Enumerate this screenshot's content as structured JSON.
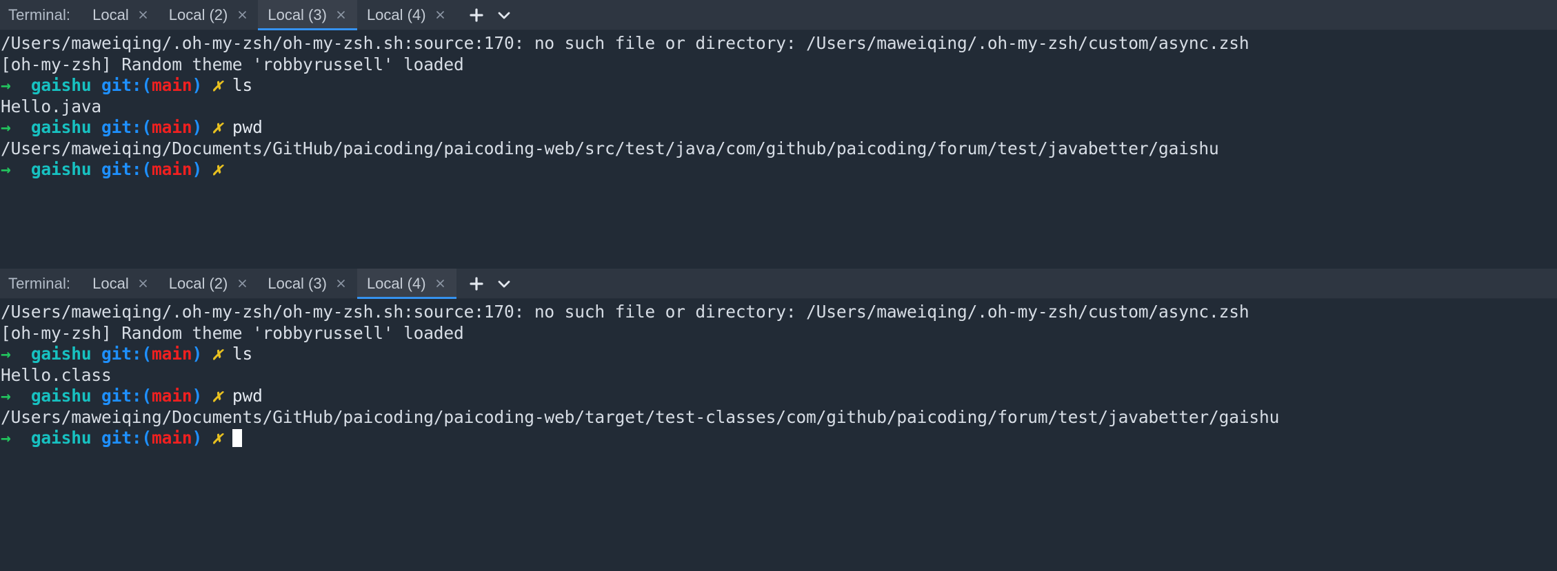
{
  "theme": {
    "terminal_bg": "#222b36",
    "tabbar_bg": "#2e3641",
    "active_tab_bg": "#39404b",
    "active_tab_underline": "#3592f0",
    "text": "#d7dde5",
    "prompt_arrow": "#22c55e",
    "prompt_dir": "#17c1c1",
    "prompt_git": "#1e90ff",
    "prompt_branch": "#f02020",
    "prompt_dirty": "#e8c020"
  },
  "terminals": [
    {
      "tabbar": {
        "label": "Terminal:",
        "tabs": [
          {
            "title": "Local",
            "close": "×",
            "active": false
          },
          {
            "title": "Local (2)",
            "close": "×",
            "active": false
          },
          {
            "title": "Local (3)",
            "close": "×",
            "active": true
          },
          {
            "title": "Local (4)",
            "close": "×",
            "active": false
          }
        ],
        "add_tab_label": "+",
        "options_label": "⌄"
      },
      "lines": [
        {
          "type": "output",
          "text": "/Users/maweiqing/.oh-my-zsh/oh-my-zsh.sh:source:170: no such file or directory: /Users/maweiqing/.oh-my-zsh/custom/async.zsh"
        },
        {
          "type": "output",
          "text": "[oh-my-zsh] Random theme 'robbyrussell' loaded"
        },
        {
          "type": "prompt",
          "arrow": "→",
          "dir": "gaishu",
          "git_open": "git:(",
          "branch": "main",
          "git_close": ")",
          "dirty": "✗",
          "command": "ls"
        },
        {
          "type": "output",
          "text": "Hello.java"
        },
        {
          "type": "prompt",
          "arrow": "→",
          "dir": "gaishu",
          "git_open": "git:(",
          "branch": "main",
          "git_close": ")",
          "dirty": "✗",
          "command": "pwd"
        },
        {
          "type": "output",
          "text": "/Users/maweiqing/Documents/GitHub/paicoding/paicoding-web/src/test/java/com/github/paicoding/forum/test/javabetter/gaishu"
        },
        {
          "type": "prompt",
          "arrow": "→",
          "dir": "gaishu",
          "git_open": "git:(",
          "branch": "main",
          "git_close": ")",
          "dirty": "✗",
          "command": ""
        }
      ]
    },
    {
      "tabbar": {
        "label": "Terminal:",
        "tabs": [
          {
            "title": "Local",
            "close": "×",
            "active": false
          },
          {
            "title": "Local (2)",
            "close": "×",
            "active": false
          },
          {
            "title": "Local (3)",
            "close": "×",
            "active": false
          },
          {
            "title": "Local (4)",
            "close": "×",
            "active": true
          }
        ],
        "add_tab_label": "+",
        "options_label": "⌄"
      },
      "lines": [
        {
          "type": "output",
          "text": "/Users/maweiqing/.oh-my-zsh/oh-my-zsh.sh:source:170: no such file or directory: /Users/maweiqing/.oh-my-zsh/custom/async.zsh"
        },
        {
          "type": "output",
          "text": "[oh-my-zsh] Random theme 'robbyrussell' loaded"
        },
        {
          "type": "prompt",
          "arrow": "→",
          "dir": "gaishu",
          "git_open": "git:(",
          "branch": "main",
          "git_close": ")",
          "dirty": "✗",
          "command": "ls"
        },
        {
          "type": "output",
          "text": "Hello.class"
        },
        {
          "type": "prompt",
          "arrow": "→",
          "dir": "gaishu",
          "git_open": "git:(",
          "branch": "main",
          "git_close": ")",
          "dirty": "✗",
          "command": "pwd"
        },
        {
          "type": "output",
          "text": "/Users/maweiqing/Documents/GitHub/paicoding/paicoding-web/target/test-classes/com/github/paicoding/forum/test/javabetter/gaishu"
        },
        {
          "type": "prompt",
          "arrow": "→",
          "dir": "gaishu",
          "git_open": "git:(",
          "branch": "main",
          "git_close": ")",
          "dirty": "✗",
          "command": "",
          "cursor": true
        }
      ]
    }
  ]
}
